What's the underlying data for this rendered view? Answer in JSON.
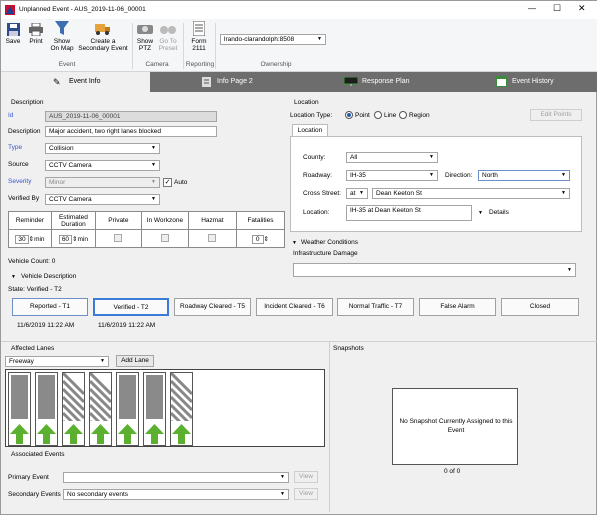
{
  "window": {
    "title": "Unplanned Event - AUS_2019-11-06_00001",
    "min": "—",
    "max": "☐",
    "close": "✕"
  },
  "ribbon": {
    "save": "Save",
    "print": "Print",
    "show_on_map": [
      "Show",
      "On Map"
    ],
    "create_secondary": [
      "Create a",
      "Secondary Event"
    ],
    "show_ptz": [
      "Show",
      "PTZ"
    ],
    "go_to_preset": [
      "Go To",
      "Preset"
    ],
    "form_2111": [
      "Form",
      "2111"
    ],
    "ownership_value": "lrando-clarandolph:8508",
    "groups": {
      "event": "Event",
      "camera": "Camera",
      "reporting": "Reporting",
      "ownership": "Ownership"
    }
  },
  "tabs": [
    {
      "label": "Event Info",
      "active": true
    },
    {
      "label": "Info Page 2",
      "active": false
    },
    {
      "label": "Response Plan",
      "active": false
    },
    {
      "label": "Event History",
      "active": false
    }
  ],
  "description": {
    "header": "Description",
    "id_label": "Id",
    "id_value": "AUS_2019-11-06_00001",
    "desc_label": "Description",
    "desc_value": "Major accident, two right lanes blocked",
    "type_label": "Type",
    "type_value": "Collision",
    "source_label": "Source",
    "source_value": "CCTV Camera",
    "severity_label": "Severity",
    "severity_value": "Minor",
    "auto_label": "Auto",
    "auto_checked": true,
    "verified_by_label": "Verified By",
    "verified_by_value": "CCTV Camera"
  },
  "reminder_table": {
    "headers": [
      "Reminder",
      "Estimated Duration",
      "Private",
      "In Workzone",
      "Hazmat",
      "Fatalities"
    ],
    "reminder_value": "30",
    "reminder_unit": "min",
    "duration_value": "60",
    "duration_unit": "min",
    "fatalities_value": "0"
  },
  "vehicle": {
    "count_label": "Vehicle Count: 0",
    "desc_toggle": "Vehicle Description"
  },
  "state": {
    "label": "State: Verified - T2",
    "stages": [
      {
        "label": "Reported - T1",
        "time": "11/6/2019 11:22 AM"
      },
      {
        "label": "Verified - T2",
        "time": "11/6/2019 11:22 AM"
      },
      {
        "label": "Roadway Cleared - T5",
        "time": ""
      },
      {
        "label": "Incident Cleared - T6",
        "time": ""
      },
      {
        "label": "Normal Traffic - T7",
        "time": ""
      },
      {
        "label": "False Alarm",
        "time": ""
      },
      {
        "label": "Closed",
        "time": ""
      }
    ]
  },
  "location": {
    "header": "Location",
    "type_label": "Location Type:",
    "type_options": [
      "Point",
      "Line",
      "Region"
    ],
    "type_selected": "Point",
    "edit_points": "Edit Points",
    "subtab": "Location",
    "county_label": "County:",
    "county_value": "All",
    "roadway_label": "Roadway:",
    "roadway_value": "IH-35",
    "direction_label": "Direction:",
    "direction_value": "North",
    "cross_label": "Cross Street:",
    "cross_rel": "at",
    "cross_value": "Dean Keeton St",
    "loc_label": "Location:",
    "loc_value": "IH-35 at Dean Keeton St",
    "details": "Details"
  },
  "weather": {
    "toggle": "Weather Conditions",
    "infra_label": "Infrastructure Damage"
  },
  "lanes": {
    "header": "Affected Lanes",
    "road_type": "Freeway",
    "add_lane": "Add Lane",
    "lane_states": [
      "open",
      "open",
      "blocked",
      "blocked",
      "open",
      "open",
      "blocked"
    ]
  },
  "snapshots": {
    "header": "Snapshots",
    "empty": "No Snapshot Currently Assigned to this Event",
    "counter": "0  of  0"
  },
  "associated": {
    "header": "Associated Events",
    "primary_label": "Primary Event",
    "primary_value": "",
    "secondary_label": "Secondary Events",
    "secondary_value": "No secondary events",
    "view": "View"
  }
}
